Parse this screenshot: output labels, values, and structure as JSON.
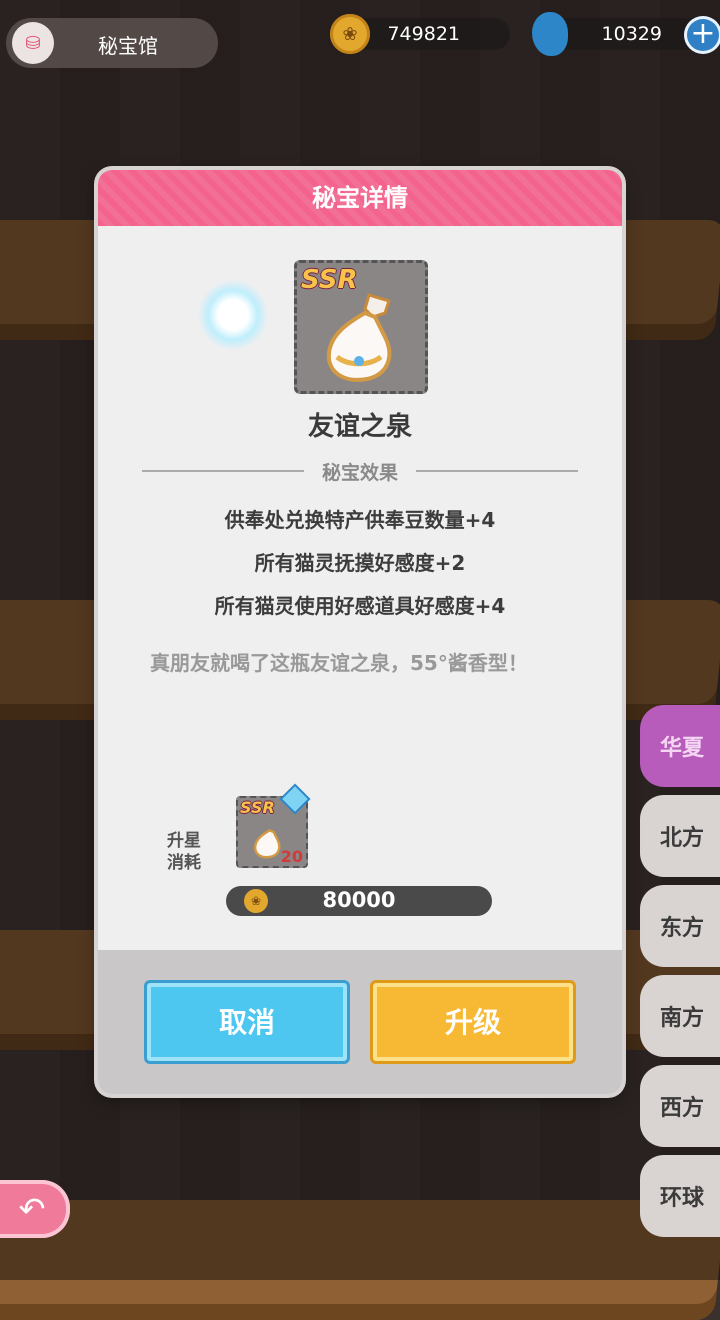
{
  "header": {
    "title": "秘宝馆",
    "coins": "749821",
    "gems": "10329"
  },
  "dialog": {
    "title": "秘宝详情",
    "item": {
      "rarity": "SSR",
      "name": "友谊之泉"
    },
    "effects_title": "秘宝效果",
    "effects": [
      "供奉处兑换特产供奉豆数量+4",
      "所有猫灵抚摸好感度+2",
      "所有猫灵使用好感道具好感度+4"
    ],
    "flavor_text": "真朋友就喝了这瓶友谊之泉，55°酱香型！",
    "upgrade_cost": {
      "label": "升星消耗",
      "item_rarity": "SSR",
      "item_count": "20",
      "coin_amount": "80000"
    },
    "buttons": {
      "cancel": "取消",
      "upgrade": "升级"
    }
  },
  "region_tabs": [
    "华夏",
    "北方",
    "东方",
    "南方",
    "西方",
    "环球"
  ],
  "active_region_index": 0,
  "colors": {
    "header_pink": "#f4638e",
    "cancel_blue": "#4dc6f0",
    "upgrade_gold": "#f7b834",
    "active_tab_purple": "#b85cbc"
  }
}
